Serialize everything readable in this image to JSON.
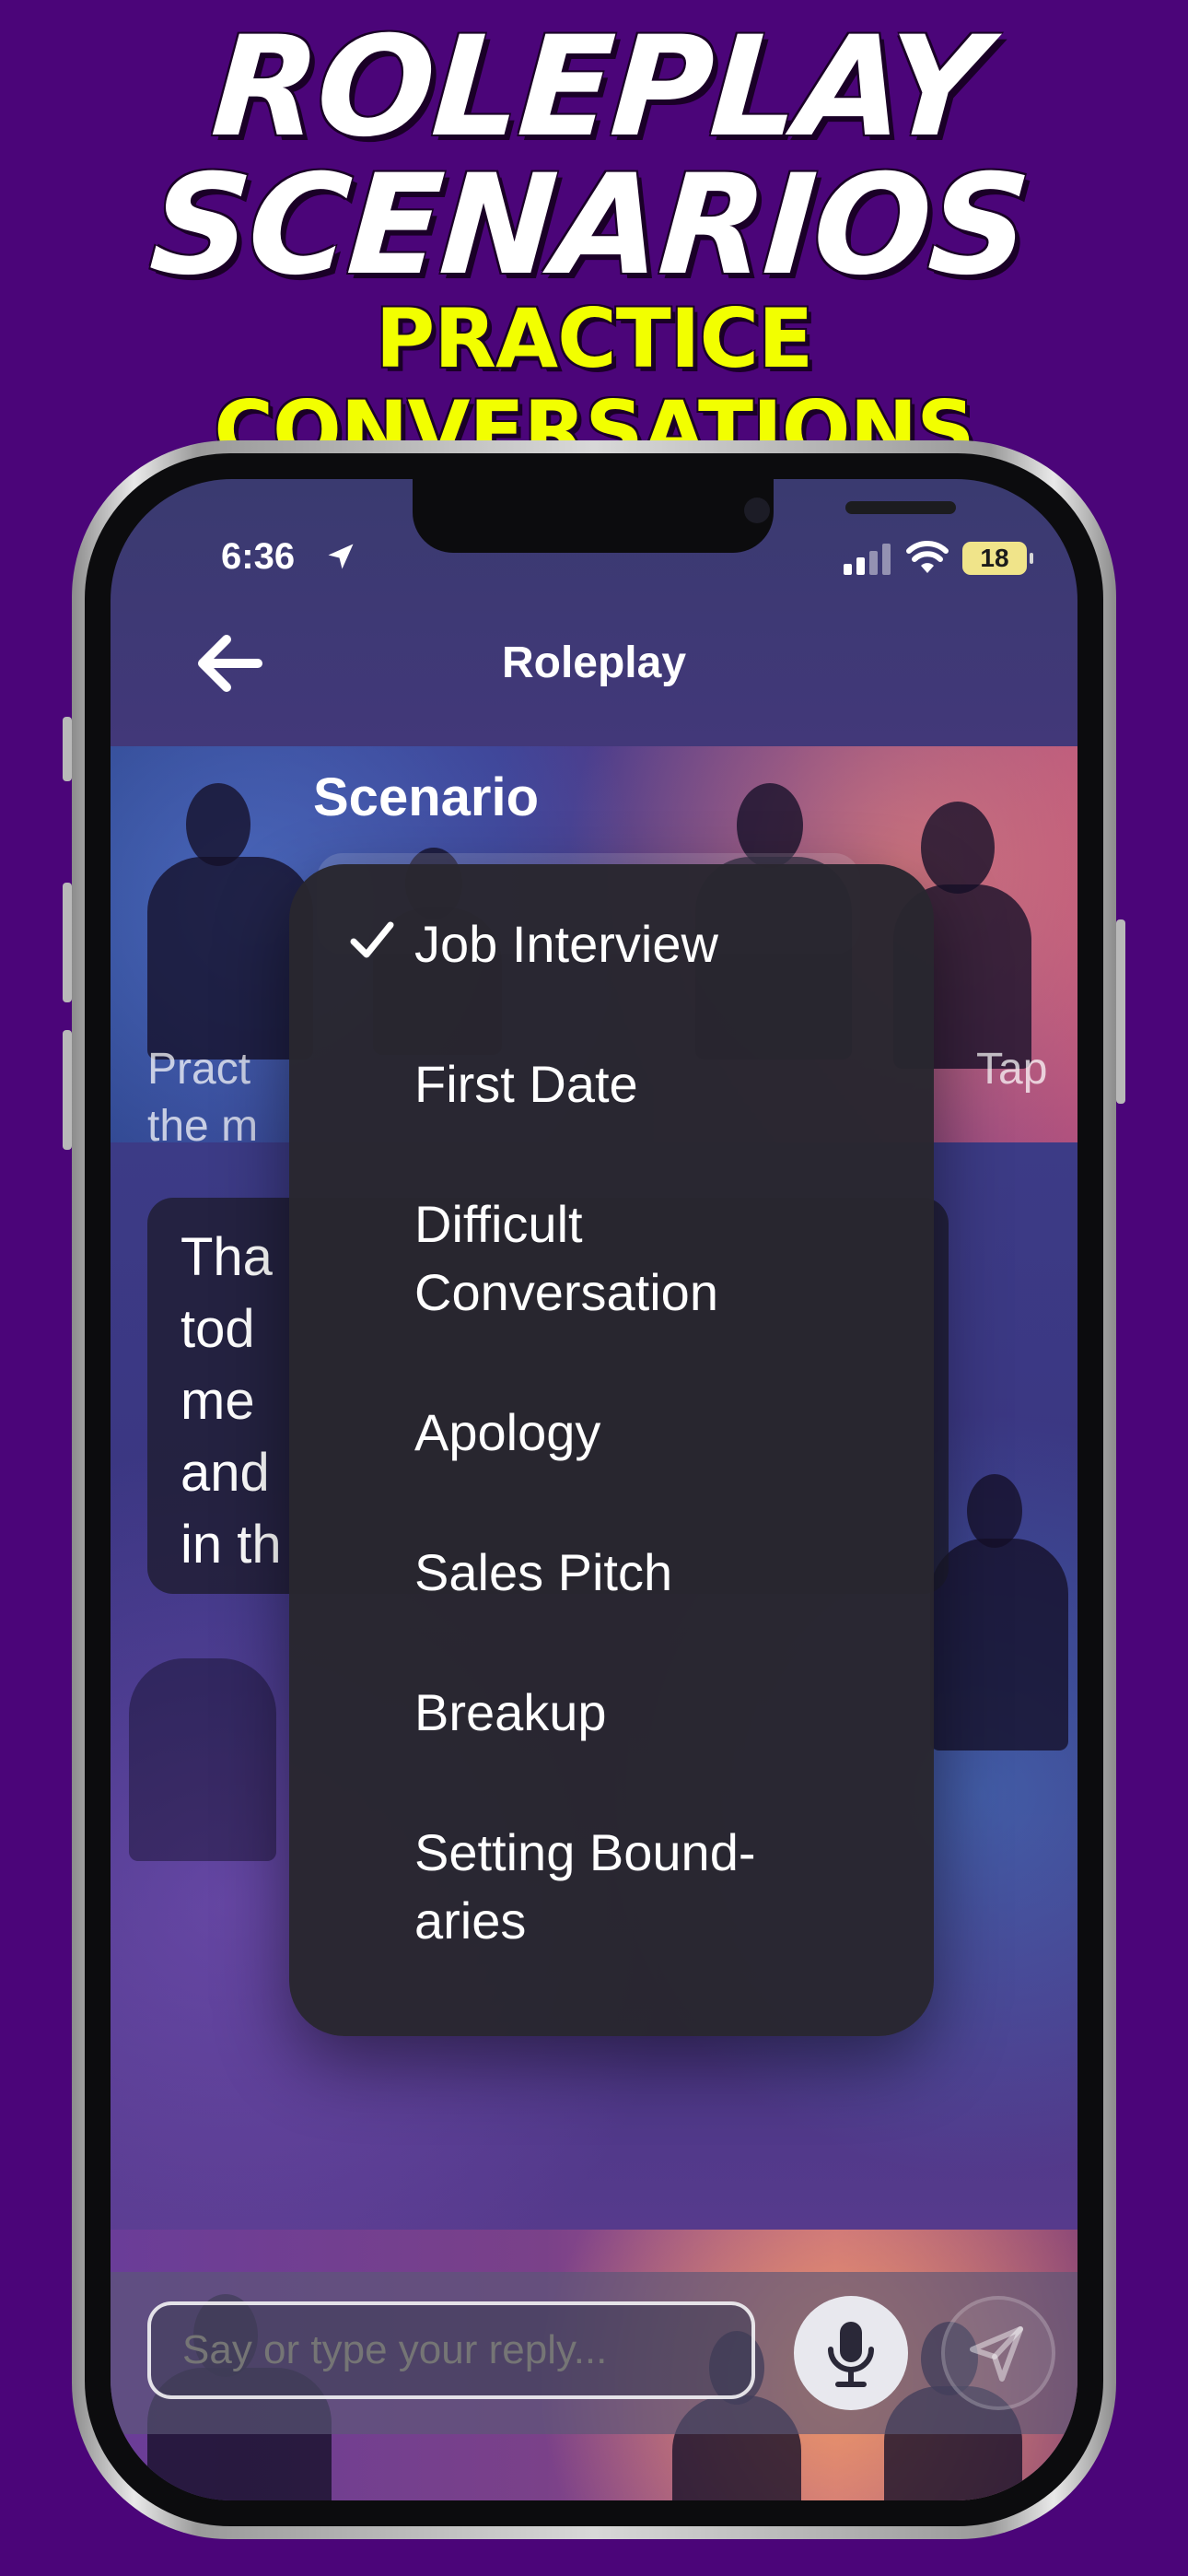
{
  "promo": {
    "headline_line1": "ROLEPLAY",
    "headline_line2": "SCENARIOS",
    "subhead": "PRACTICE CONVERSATIONS",
    "background_color": "#4b0579",
    "headline_color": "#ffffff",
    "subhead_color": "#f2ff00"
  },
  "status_bar": {
    "time": "6:36",
    "location_icon": "location-arrow-icon",
    "signal_icon": "cellular-signal-icon",
    "wifi_icon": "wifi-icon",
    "battery": "18"
  },
  "nav": {
    "back_icon": "arrow-left-icon",
    "title": "Roleplay"
  },
  "content": {
    "section_title": "Scenario",
    "instructions_start": "Pract",
    "instructions_start_line2": "the m",
    "instructions_end": "Tap",
    "message_lines": [
      "Tha",
      "tod",
      "me",
      "and",
      "in th"
    ]
  },
  "menu": {
    "selected_index": 0,
    "check_icon": "checkmark-icon",
    "items": [
      "Job Interview",
      "First Date",
      "Difficult Conversation",
      "Apology",
      "Sales Pitch",
      "Breakup",
      "Setting Bound-aries"
    ]
  },
  "input_bar": {
    "placeholder": "Say or type your reply...",
    "mic_icon": "microphone-icon",
    "send_icon": "send-icon"
  }
}
